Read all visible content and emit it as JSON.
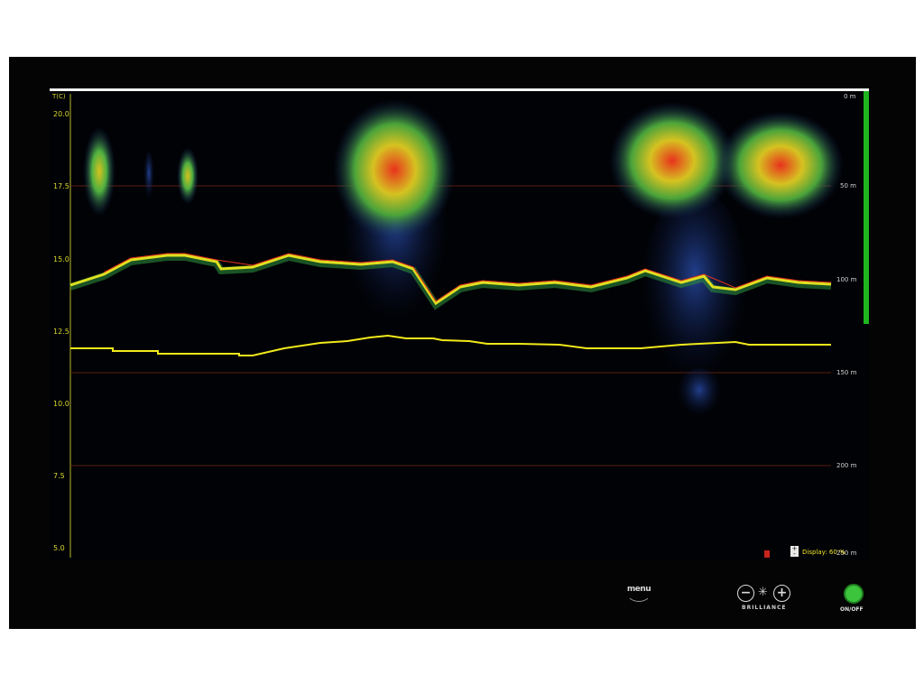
{
  "screen": {
    "temperature_unit": "T(C)",
    "temperature_ticks": [
      "20.0",
      "17.5",
      "15.0",
      "12.5",
      "10.0",
      "7.5",
      "5.0"
    ],
    "depth_ticks": [
      "0 m",
      "50 m",
      "100 m",
      "150 m",
      "200 m",
      "250 m"
    ],
    "display_label": "Display: 60 %",
    "display_toggle_label": "+ -"
  },
  "controls": {
    "menu_label": "menu",
    "brightness_minus": "−",
    "brightness_plus": "+",
    "brightness_sun": "✳",
    "brightness_label": "BRILLIANCE",
    "onoff_label": "ON/OFF"
  },
  "colors": {
    "temperature_axis": "#d8d82a",
    "temperature_trace": "#f2ea1a",
    "bottom_echo": "#e0e020",
    "fish_strong": "#e8321c",
    "fish_mid": "#6fcf3c",
    "fish_weak": "#1a3fa0",
    "depth_bar": "#1fb51f"
  }
}
